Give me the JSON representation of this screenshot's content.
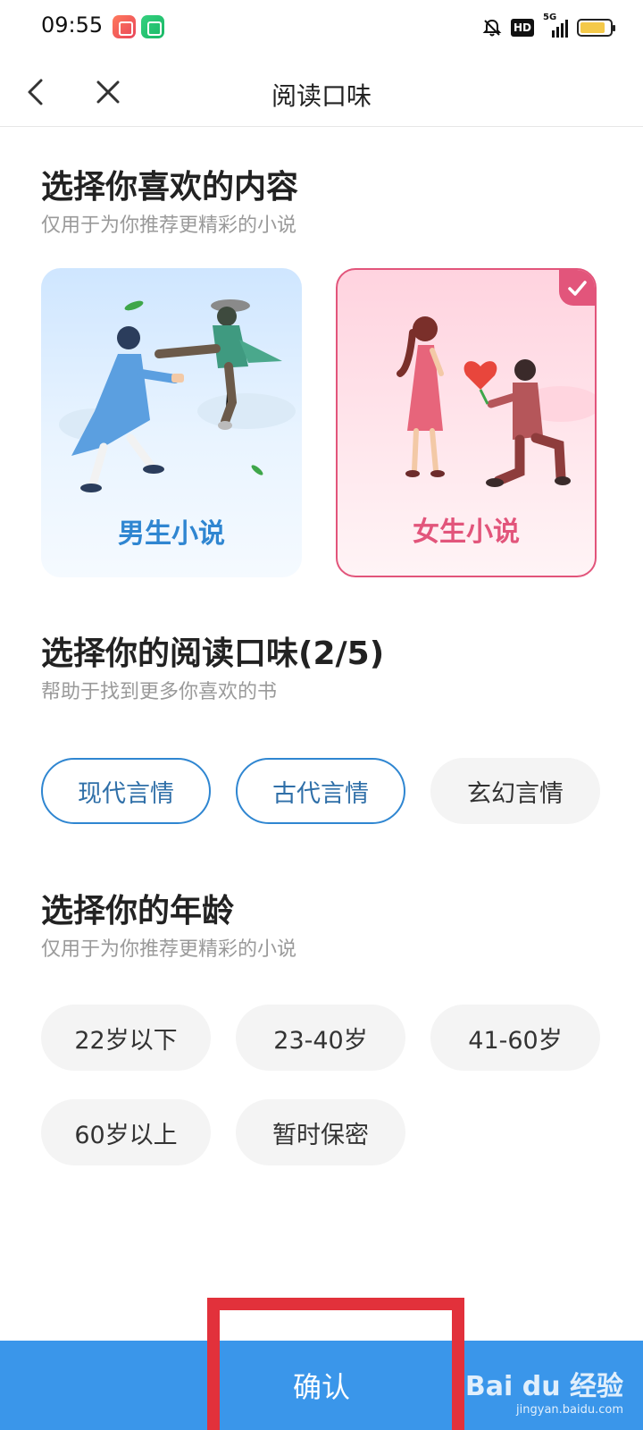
{
  "status_bar": {
    "time": "09:55",
    "hd": "HD",
    "network": "5G",
    "battery_level": 0.85
  },
  "nav": {
    "title": "阅读口味"
  },
  "content_section": {
    "title": "选择你喜欢的内容",
    "subtitle": "仅用于为你推荐更精彩的小说"
  },
  "gender_cards": [
    {
      "label": "男生小说",
      "selected": false
    },
    {
      "label": "女生小说",
      "selected": true
    }
  ],
  "taste_section": {
    "title": "选择你的阅读口味(2/5)",
    "subtitle": "帮助于找到更多你喜欢的书",
    "chips": [
      {
        "label": "现代言情",
        "selected": true
      },
      {
        "label": "古代言情",
        "selected": true
      },
      {
        "label": "玄幻言情",
        "selected": false
      }
    ]
  },
  "age_section": {
    "title": "选择你的年龄",
    "subtitle": "仅用于为你推荐更精彩的小说",
    "chips": [
      {
        "label": "22岁以下"
      },
      {
        "label": "23-40岁"
      },
      {
        "label": "41-60岁"
      },
      {
        "label": "60岁以上"
      },
      {
        "label": "暂时保密"
      }
    ]
  },
  "confirm": {
    "label": "确认"
  },
  "watermark": {
    "brand": "Bai du 经验",
    "url": "jingyan.baidu.com"
  },
  "colors": {
    "accent_blue": "#3a96ea",
    "accent_pink": "#e2557b",
    "highlight_red": "#e2313b"
  }
}
